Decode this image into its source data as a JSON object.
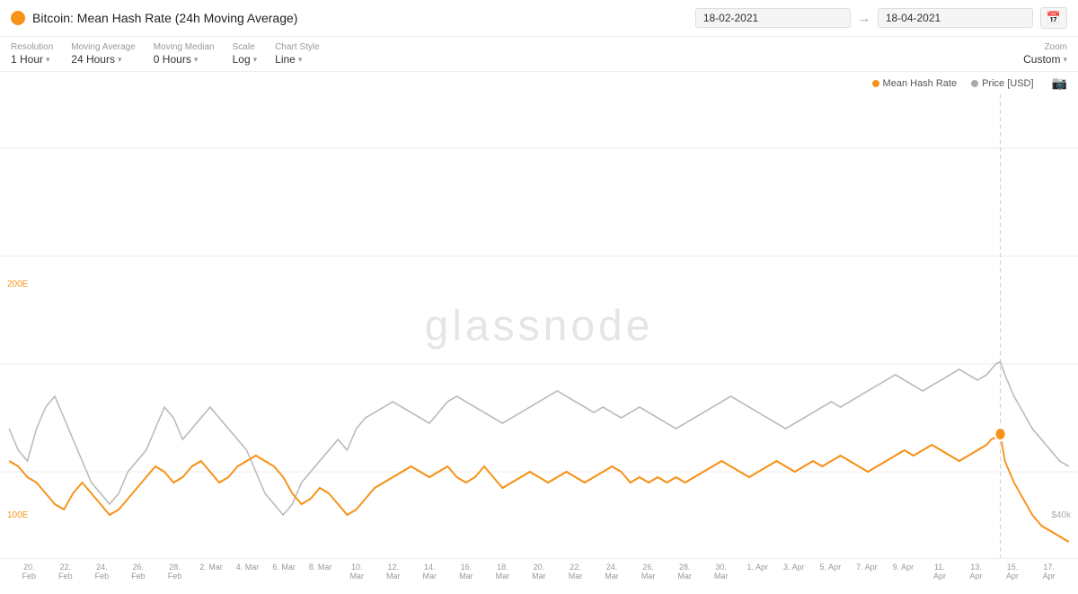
{
  "header": {
    "title": "Bitcoin: Mean Hash Rate (24h Moving Average)",
    "date_start": "18-02-2021",
    "date_end": "18-04-2021"
  },
  "controls": {
    "resolution_label": "Resolution",
    "resolution_value": "1 Hour",
    "moving_average_label": "Moving Average",
    "moving_average_value": "24 Hours",
    "moving_median_label": "Moving Median",
    "moving_median_value": "0 Hours",
    "scale_label": "Scale",
    "scale_value": "Log",
    "chart_style_label": "Chart Style",
    "chart_style_value": "Line",
    "zoom_label": "Zoom",
    "zoom_value": "Custom"
  },
  "legend": {
    "mean_hash_rate_label": "Mean Hash Rate",
    "price_usd_label": "Price [USD]"
  },
  "chart": {
    "y_label_200e": "200E",
    "y_label_100e": "100E",
    "y_label_40k": "$40k",
    "watermark": "glassnode"
  },
  "xaxis": {
    "ticks": [
      {
        "line1": "20.",
        "line2": "Feb"
      },
      {
        "line1": "22.",
        "line2": "Feb"
      },
      {
        "line1": "24.",
        "line2": "Feb"
      },
      {
        "line1": "26.",
        "line2": "Feb"
      },
      {
        "line1": "28.",
        "line2": "Feb"
      },
      {
        "line1": "2. Mar",
        "line2": ""
      },
      {
        "line1": "4. Mar",
        "line2": ""
      },
      {
        "line1": "6. Mar",
        "line2": ""
      },
      {
        "line1": "8. Mar",
        "line2": ""
      },
      {
        "line1": "10.",
        "line2": "Mar"
      },
      {
        "line1": "12.",
        "line2": "Mar"
      },
      {
        "line1": "14.",
        "line2": "Mar"
      },
      {
        "line1": "16.",
        "line2": "Mar"
      },
      {
        "line1": "18.",
        "line2": "Mar"
      },
      {
        "line1": "20.",
        "line2": "Mar"
      },
      {
        "line1": "22.",
        "line2": "Mar"
      },
      {
        "line1": "24.",
        "line2": "Mar"
      },
      {
        "line1": "26.",
        "line2": "Mar"
      },
      {
        "line1": "28.",
        "line2": "Mar"
      },
      {
        "line1": "30.",
        "line2": "Mar"
      },
      {
        "line1": "1. Apr",
        "line2": ""
      },
      {
        "line1": "3. Apr",
        "line2": ""
      },
      {
        "line1": "5. Apr",
        "line2": ""
      },
      {
        "line1": "7. Apr",
        "line2": ""
      },
      {
        "line1": "9. Apr",
        "line2": ""
      },
      {
        "line1": "11.",
        "line2": "Apr"
      },
      {
        "line1": "13.",
        "line2": "Apr"
      },
      {
        "line1": "15.",
        "line2": "Apr"
      },
      {
        "line1": "17.",
        "line2": "Apr"
      }
    ]
  }
}
